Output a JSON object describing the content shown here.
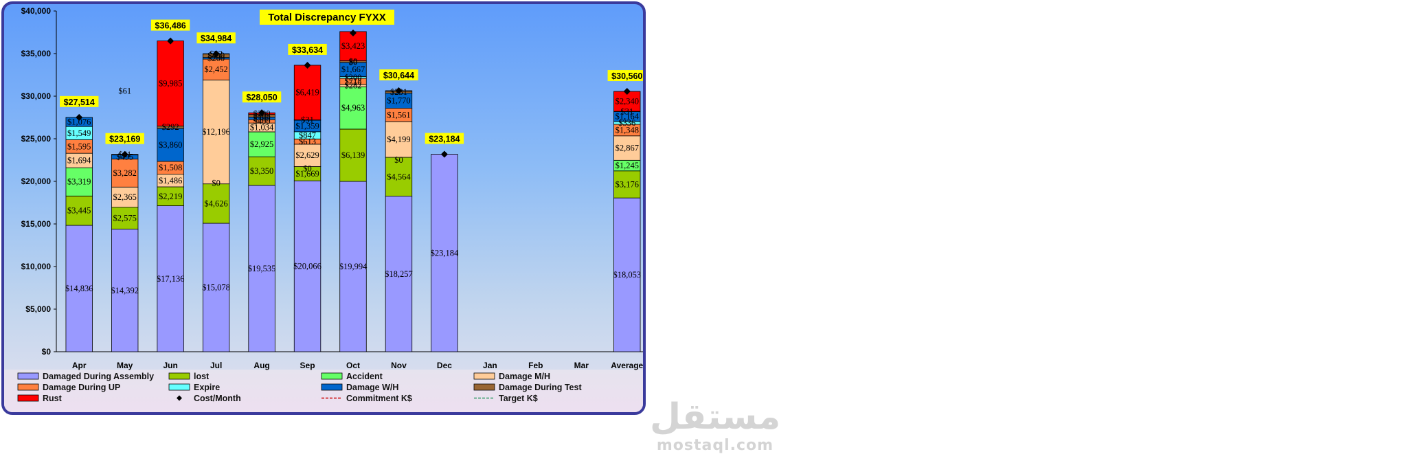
{
  "chart_data": {
    "type": "bar",
    "stacked": true,
    "title": "Total Discrepancy FYXX",
    "categories": [
      "Apr",
      "May",
      "Jun",
      "Jul",
      "Aug",
      "Sep",
      "Oct",
      "Nov",
      "Dec",
      "Jan",
      "Feb",
      "Mar",
      "Average"
    ],
    "ylim": [
      0,
      40000
    ],
    "yticks": [
      0,
      5000,
      10000,
      15000,
      20000,
      25000,
      30000,
      35000,
      40000
    ],
    "ytick_labels": [
      "$0",
      "$5,000",
      "$10,000",
      "$15,000",
      "$20,000",
      "$25,000",
      "$30,000",
      "$35,000",
      "$40,000"
    ],
    "grid": false,
    "legend_position": "bottom",
    "series": [
      {
        "name": "Damaged During Assembly",
        "color": "#9999ff",
        "values": [
          14836,
          14392,
          17136,
          15078,
          19535,
          20066,
          19994,
          18257,
          23184,
          null,
          null,
          null,
          18053
        ],
        "labels": [
          "$14,836",
          "$14,392",
          "$17,136",
          "$15,078",
          "$19,535",
          "$20,066",
          "$19,994",
          "$18,257",
          "$23,184",
          "",
          "",
          "",
          "$18,053"
        ]
      },
      {
        "name": "lost",
        "color": "#99cc00",
        "values": [
          3445,
          2575,
          2219,
          4626,
          3350,
          1669,
          6139,
          4564,
          null,
          null,
          null,
          null,
          3176
        ],
        "labels": [
          "$3,445",
          "$2,575",
          "$2,219",
          "$4,626",
          "$3,350",
          "$1,669",
          "$6,139",
          "$4,564",
          "",
          "",
          "",
          "",
          "$3,176"
        ]
      },
      {
        "name": "Accident",
        "color": "#66ff66",
        "values": [
          3319,
          null,
          null,
          null,
          2925,
          null,
          4963,
          null,
          null,
          null,
          null,
          null,
          1245
        ],
        "labels": [
          "$3,319",
          "",
          "",
          "",
          "$2,925",
          "",
          "$4,963",
          "",
          "",
          "",
          "",
          "",
          "$1,245"
        ]
      },
      {
        "name": "Damage M/H",
        "color": "#ffcc99",
        "values": [
          1694,
          2365,
          1486,
          12196,
          1034,
          2629,
          282,
          4199,
          null,
          null,
          null,
          null,
          2867
        ],
        "labels": [
          "$1,694",
          "$2,365",
          "$1,486",
          "$12,196",
          "$1,034",
          "$2,629",
          "$282",
          "$4,199",
          "",
          "",
          "",
          "",
          "$2,867"
        ]
      },
      {
        "name": "Damage During UP",
        "color": "#ff8040",
        "values": [
          1595,
          3282,
          1508,
          2452,
          400,
          613,
          718,
          1561,
          null,
          null,
          null,
          null,
          1348
        ],
        "labels": [
          "$1,595",
          "$3,282",
          "$1,508",
          "$2,452",
          "$400",
          "$613",
          "$718",
          "$1,561",
          "",
          "",
          "",
          "",
          "$1,348"
        ]
      },
      {
        "name": "Expire",
        "color": "#66ffff",
        "values": [
          1549,
          null,
          null,
          null,
          null,
          847,
          200,
          null,
          null,
          null,
          null,
          null,
          336
        ],
        "labels": [
          "$1,549",
          "",
          "",
          "",
          "",
          "$847",
          "$200",
          "",
          "",
          "",
          "",
          "",
          "$336"
        ]
      },
      {
        "name": "Damage W/H",
        "color": "#0066cc",
        "values": [
          1076,
          495,
          3860,
          200,
          300,
          1359,
          1667,
          1770,
          null,
          null,
          null,
          null,
          1164
        ],
        "labels": [
          "$1,076",
          "$495",
          "$3,860",
          "$200",
          "$300",
          "$1,359",
          "$1,667",
          "$1,770",
          "",
          "",
          "",
          "",
          "$1,164"
        ]
      },
      {
        "name": "Damage During Test",
        "color": "#996633",
        "values": [
          null,
          61,
          292,
          400,
          306,
          31,
          200,
          231,
          null,
          null,
          null,
          null,
          31
        ],
        "labels": [
          "",
          "$61",
          "$292",
          "$400",
          "$306",
          "$31",
          "$0",
          "$231",
          "",
          "",
          "",
          "",
          "$31"
        ]
      },
      {
        "name": "Rust",
        "color": "#ff0000",
        "values": [
          null,
          null,
          9985,
          32,
          200,
          6419,
          3423,
          62,
          null,
          null,
          null,
          null,
          2340
        ],
        "labels": [
          "",
          "",
          "$9,985",
          "$32",
          "$200",
          "$6,419",
          "$3,423",
          "",
          "",
          "",
          "",
          "",
          "$2,340"
        ]
      }
    ],
    "cost_month": {
      "name": "Cost/Month",
      "values": [
        27514,
        23169,
        36486,
        34984,
        28050,
        33634,
        37423,
        30644,
        23184,
        null,
        null,
        null,
        30560
      ],
      "labels": [
        "$27,514",
        "$23,169",
        "$36,486",
        "$34,984",
        "$28,050",
        "$33,634",
        "",
        "$30,644",
        "$23,184",
        "",
        "",
        "",
        "$30,560"
      ]
    },
    "lines": [
      {
        "name": "Commitment K$",
        "color": "#cc0000",
        "dash": "dashed"
      },
      {
        "name": "Target K$",
        "color": "#339966",
        "dash": "dashed"
      }
    ],
    "extra_labels": [
      {
        "category": "May",
        "text": "$61",
        "y": 30600
      },
      {
        "category": "Jul",
        "text": "$0",
        "y": 19800
      },
      {
        "category": "Sep",
        "text": "$0",
        "y": 21500
      },
      {
        "category": "Oct",
        "text": "$0",
        "y": 34000
      },
      {
        "category": "Nov",
        "text": "$0",
        "y": 22500
      }
    ],
    "legend_order": [
      "Damaged During Assembly",
      "lost",
      "Accident",
      "Damage M/H",
      "Damage During UP",
      "Expire",
      "Damage W/H",
      "Damage During Test",
      "Rust",
      "Cost/Month",
      "Commitment K$",
      "Target K$"
    ]
  },
  "watermark": {
    "arabic": "مستقل",
    "latin": "mostaql.com"
  }
}
